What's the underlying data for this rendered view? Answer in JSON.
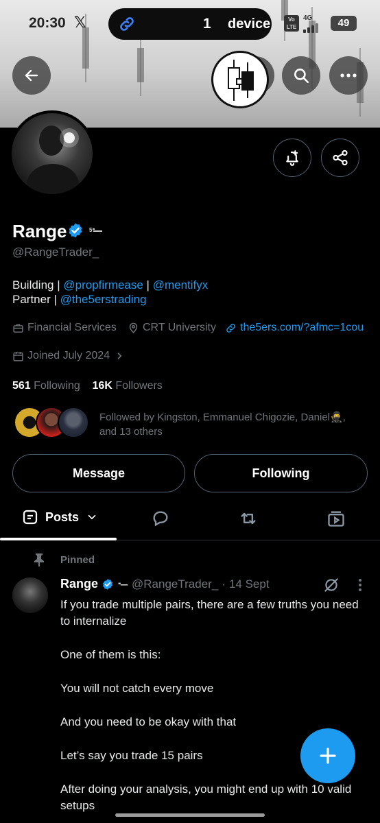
{
  "status_bar": {
    "time": "20:30",
    "x_logo": "𝕏",
    "device_pill_count": "1",
    "device_pill_label": "device",
    "volte": "Vo LTE",
    "network": "4G",
    "battery": "49"
  },
  "profile": {
    "name": "Range",
    "handle": "@RangeTrader_",
    "bio_line1_prefix": "Building | ",
    "bio_link1": "@propfirmease",
    "bio_sep": " | ",
    "bio_link2": "@mentifyx",
    "bio_line2_prefix": "Partner | ",
    "bio_link3": "@the5erstrading",
    "category": "Financial Services",
    "location": "CRT University",
    "website": "the5ers.com/?afmc=1cou",
    "joined": "Joined July 2024",
    "following_count": "561",
    "following_label": "Following",
    "followers_count": "16K",
    "followers_label": "Followers",
    "followed_by_line1": "Followed by Kingston, Emmanuel Chigozie, Daniel🥷,",
    "followed_by_line2": "and 13 others"
  },
  "actions": {
    "message": "Message",
    "following": "Following"
  },
  "tabs": {
    "posts": "Posts"
  },
  "post": {
    "pinned_label": "Pinned",
    "author_name": "Range",
    "author_handle": "@RangeTrader_",
    "separator": "·",
    "date": "14 Sept",
    "paragraphs": [
      "If you trade multiple pairs, there are a few truths you need to internalize",
      "One of them is this:",
      "You will not catch every move",
      "And you need to be okay with that",
      "Let’s say you trade 15 pairs",
      "After doing your analysis, you might end up with 10 valid setups"
    ]
  },
  "colors": {
    "accent": "#1d9bf0",
    "background": "#000000",
    "muted": "#71767b",
    "border": "#536471"
  },
  "icons": [
    "back-arrow-icon",
    "grok-icon",
    "search-icon",
    "more-icon",
    "bell-plus-icon",
    "share-icon",
    "briefcase-icon",
    "location-icon",
    "link-icon",
    "calendar-icon",
    "chevron-right-icon",
    "posts-icon",
    "chevron-down-icon",
    "replies-icon",
    "reposts-icon",
    "media-icon",
    "pin-icon",
    "verified-icon",
    "more-vertical-icon",
    "plus-icon"
  ]
}
